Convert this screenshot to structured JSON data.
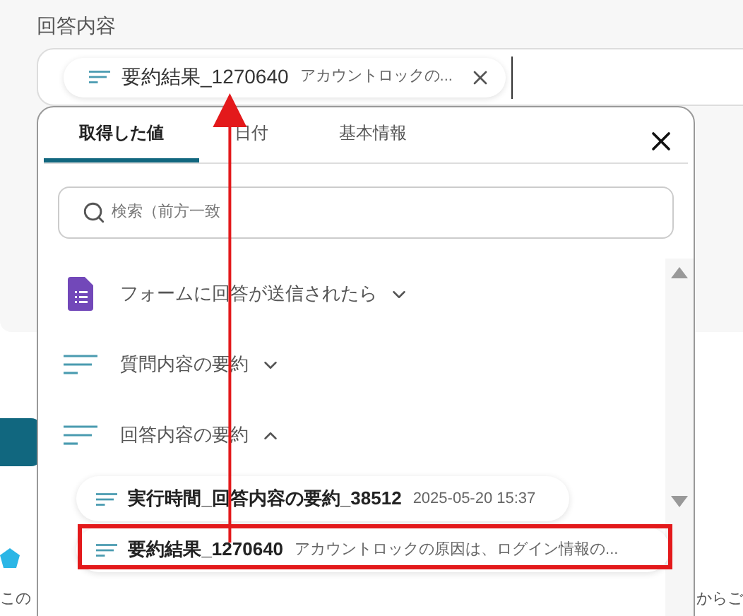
{
  "field": {
    "label": "回答内容",
    "chip": {
      "name": "要約結果_1270640",
      "preview": "アカウントロックの..."
    }
  },
  "popup": {
    "tabs": [
      {
        "label": "取得した値",
        "selected": true
      },
      {
        "label": "日付",
        "selected": false
      },
      {
        "label": "基本情報",
        "selected": false
      }
    ],
    "search": {
      "placeholder": "検索（前方一致"
    },
    "groups": [
      {
        "kind": "form",
        "label": "フォームに回答が送信されたら",
        "expanded": false
      },
      {
        "kind": "text",
        "label": "質問内容の要約",
        "expanded": false
      },
      {
        "kind": "text",
        "label": "回答内容の要約",
        "expanded": true,
        "items": [
          {
            "name": "実行時間_回答内容の要約_38512",
            "value": "2025-05-20 15:37",
            "highlighted": false
          },
          {
            "name": "要約結果_1270640",
            "value": "アカウントロックの原因は、ログイン情報の...",
            "highlighted": true
          }
        ]
      }
    ]
  },
  "background": {
    "notes": [
      "この",
      "からご"
    ]
  }
}
